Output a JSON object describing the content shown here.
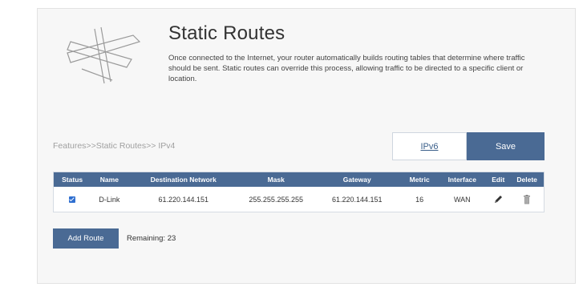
{
  "header": {
    "title": "Static Routes",
    "description": "Once connected to the Internet, your router automatically builds routing tables that determine where traffic should be sent. Static routes can override this process, allowing traffic to be directed to a specific client or location."
  },
  "breadcrumb": "Features>>Static Routes>> IPv4",
  "toolbar": {
    "ipv6_label": "IPv6",
    "save_label": "Save"
  },
  "table": {
    "columns": [
      "Status",
      "Name",
      "Destination Network",
      "Mask",
      "Gateway",
      "Metric",
      "Interface",
      "Edit",
      "Delete"
    ],
    "rows": [
      {
        "status": "checked",
        "name": "D-Link",
        "destination": "61.220.144.151",
        "mask": "255.255.255.255",
        "gateway": "61.220.144.151",
        "metric": "16",
        "interface": "WAN",
        "edit_icon": "pencil-icon",
        "delete_icon": "trash-icon"
      }
    ]
  },
  "footer": {
    "add_route_label": "Add Route",
    "remaining_text": "Remaining: 23"
  },
  "colors": {
    "accent": "#4a6a94",
    "checkbox": "#2f6fd0",
    "link": "#3a5f8a"
  },
  "icons": {
    "header": "signpost-icon"
  }
}
